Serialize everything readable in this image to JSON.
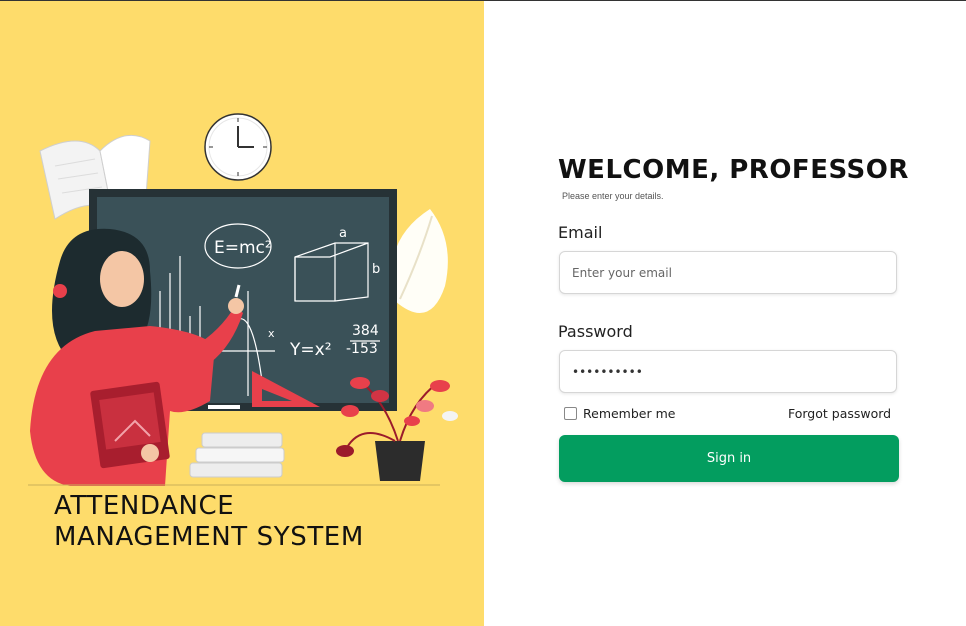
{
  "branding": {
    "title_line1": "ATTENDANCE",
    "title_line2": "MANAGEMENT SYSTEM"
  },
  "illustration": {
    "chalkboard_texts": [
      "E=mc²",
      "a",
      "b",
      "Y=x²",
      "384",
      "-153",
      "x"
    ],
    "colors": {
      "background": "#fedc6b",
      "board": "#3a5158",
      "board_frame": "#263236",
      "accent_red": "#e8404b"
    }
  },
  "login": {
    "heading": "WELCOME, PROFESSOR",
    "subheading": "Please enter your details.",
    "email_label": "Email",
    "email_placeholder": "Enter your email",
    "password_label": "Password",
    "password_value": "••••••••••",
    "remember_label": "Remember me",
    "forgot_label": "Forgot password",
    "signin_label": "Sign in",
    "accent_color": "#039d5f"
  }
}
